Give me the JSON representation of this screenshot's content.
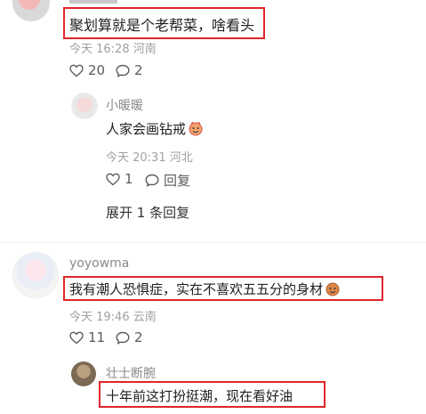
{
  "comments": [
    {
      "username": "",
      "content": "聚划算就是个老帮菜，啥看头",
      "time": "今天 16:28",
      "location": "河南",
      "likes": "20",
      "replies": "2"
    },
    {
      "username": "小暖暖",
      "content": "人家会画钻戒",
      "time": "今天 20:31",
      "location": "河北",
      "likes": "1",
      "reply_label": "回复",
      "expand": "展开 1 条回复"
    },
    {
      "username": "yoyowma",
      "content": "我有潮人恐惧症，实在不喜欢五五分的身材",
      "time": "今天 19:46",
      "location": "云南",
      "likes": "11",
      "replies": "2"
    },
    {
      "username": "壮士断腕",
      "content": "十年前这打扮挺潮，现在看好油"
    }
  ],
  "icons": {
    "like": "heart-outline-icon",
    "comment": "comment-bubble-icon",
    "emoji": "emoji-face-icon"
  },
  "colors": {
    "highlight_box": "#e0262b"
  }
}
